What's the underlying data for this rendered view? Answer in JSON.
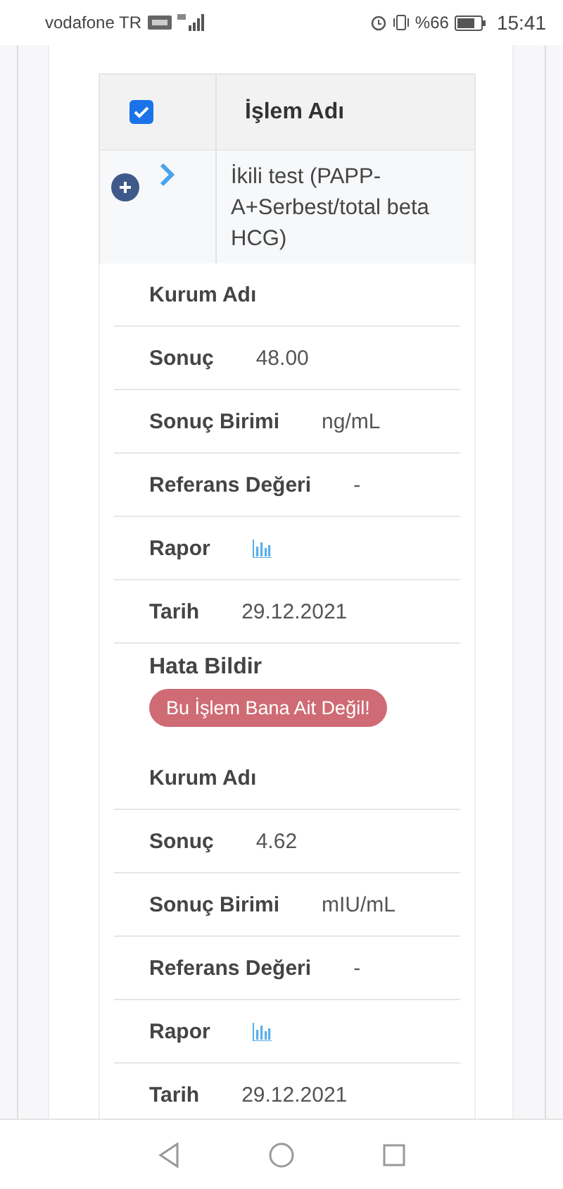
{
  "status_bar": {
    "carrier": "vodafone TR",
    "battery": "%66",
    "time": "15:41"
  },
  "table": {
    "header": {
      "checked": true,
      "column": "İşlem Adı"
    },
    "row": {
      "expanded": true,
      "name": "İkili test (PAPP-A+Serbest/total beta HCG)"
    }
  },
  "details": [
    {
      "rows": [
        {
          "kind": "text",
          "label": "Kurum Adı"
        },
        {
          "kind": "text",
          "label": "Sonuç",
          "value": "48.00"
        },
        {
          "kind": "text",
          "label": "Sonuç Birimi",
          "value": "ng/mL"
        },
        {
          "kind": "text",
          "label": "Referans Değeri",
          "value": "-"
        },
        {
          "kind": "report",
          "label": "Rapor"
        },
        {
          "kind": "text",
          "label": "Tarih",
          "value": "29.12.2021"
        }
      ],
      "error": {
        "label": "Hata Bildir",
        "button": "Bu İşlem Bana Ait Değil!"
      }
    },
    {
      "rows": [
        {
          "kind": "text",
          "label": "Kurum Adı"
        },
        {
          "kind": "text",
          "label": "Sonuç",
          "value": "4.62"
        },
        {
          "kind": "text",
          "label": "Sonuç Birimi",
          "value": "mIU/mL"
        },
        {
          "kind": "text",
          "label": "Referans Değeri",
          "value": "-"
        },
        {
          "kind": "report",
          "label": "Rapor"
        },
        {
          "kind": "text",
          "label": "Tarih",
          "value": "29.12.2021"
        }
      ]
    }
  ]
}
